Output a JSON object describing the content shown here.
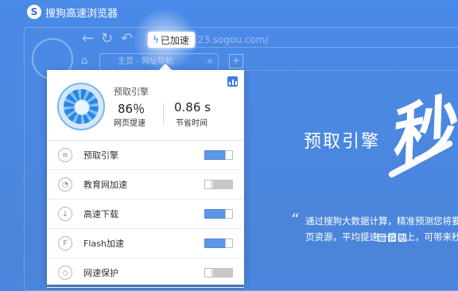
{
  "window": {
    "app_title": "搜狗高速浏览器",
    "url_text": "123.sogou.com/",
    "tab_label": "主页 - 网址导航",
    "tab_close": "×",
    "new_tab": "+"
  },
  "badge": {
    "label": "已加速"
  },
  "panel": {
    "engine_title": "预取引擎",
    "speedup_value": "86％",
    "speedup_label": "网页提速",
    "saved_value": "0.86 s",
    "saved_label": "节省时间",
    "features": [
      {
        "label": "预取引擎",
        "icon": "page-icon",
        "glyph": "≡",
        "on": true
      },
      {
        "label": "教育网加速",
        "icon": "gauge-icon",
        "glyph": "◔",
        "on": false
      },
      {
        "label": "高速下载",
        "icon": "download-icon",
        "glyph": "↓",
        "on": true
      },
      {
        "label": "Flash加速",
        "icon": "flash-icon",
        "glyph": "F",
        "on": true
      },
      {
        "label": "网速保护",
        "icon": "shield-icon",
        "glyph": "◇",
        "on": false
      }
    ]
  },
  "promo": {
    "title": "预取引擎",
    "brush_char": "秒",
    "line1": "通过搜狗大数据计算，精准预测您将要",
    "line2": "页资源，平均提速一倍以上，可带来秒"
  },
  "colors": {
    "accent": "#4a86e0",
    "toggle_on": "#5b97e6"
  }
}
